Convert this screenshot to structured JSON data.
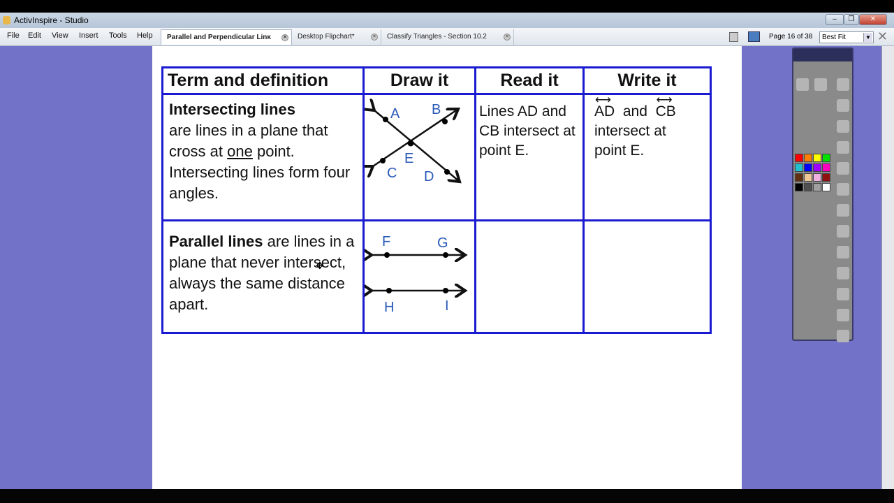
{
  "window": {
    "title": "ActivInspire - Studio",
    "controls": [
      "minimize",
      "restore",
      "close"
    ]
  },
  "menu": [
    "File",
    "Edit",
    "View",
    "Insert",
    "Tools",
    "Help"
  ],
  "tabs": [
    {
      "label": "Parallel and Perpendicular Linĸ",
      "active": true
    },
    {
      "label": "Desktop Flipchart*",
      "active": false
    },
    {
      "label": "Classify Triangles - Section 10.2",
      "active": false
    }
  ],
  "toolbar": {
    "page": "Page 16 of 38",
    "zoom": "Best Fit"
  },
  "table": {
    "headers": [
      "Term and definition",
      "Draw it",
      "Read it",
      "Write it"
    ],
    "row1": {
      "term": "Intersecting lines",
      "def_a": "are lines in a plane that cross at ",
      "def_u": "one",
      "def_b": " point. Intersecting lines form four angles.",
      "read": "Lines AD and CB intersect at point E.",
      "write_a": "AD",
      "write_and": "and",
      "write_b": "CB",
      "write_c": "intersect at point E.",
      "labels": [
        "A",
        "B",
        "C",
        "D",
        "E"
      ]
    },
    "row2": {
      "term": "Parallel lines",
      "def": " are lines in a plane that never intersect, always the same distance apart.",
      "labels": [
        "F",
        "G",
        "H",
        "I"
      ]
    }
  },
  "colors": {
    "canvas": "#7272c9",
    "table_border": "#1a1ad0",
    "point_labels": "#2a5ab8"
  },
  "toolbox": {
    "palette": [
      "#ff0000",
      "#ff8000",
      "#ffff00",
      "#00e000",
      "#20c0d0",
      "#0000ff",
      "#a000ff",
      "#ff00c0",
      "#603010",
      "#f0c898",
      "#f0b0e0",
      "#901010",
      "#000000",
      "#505050",
      "#a0a0a0",
      "#ffffff"
    ]
  }
}
